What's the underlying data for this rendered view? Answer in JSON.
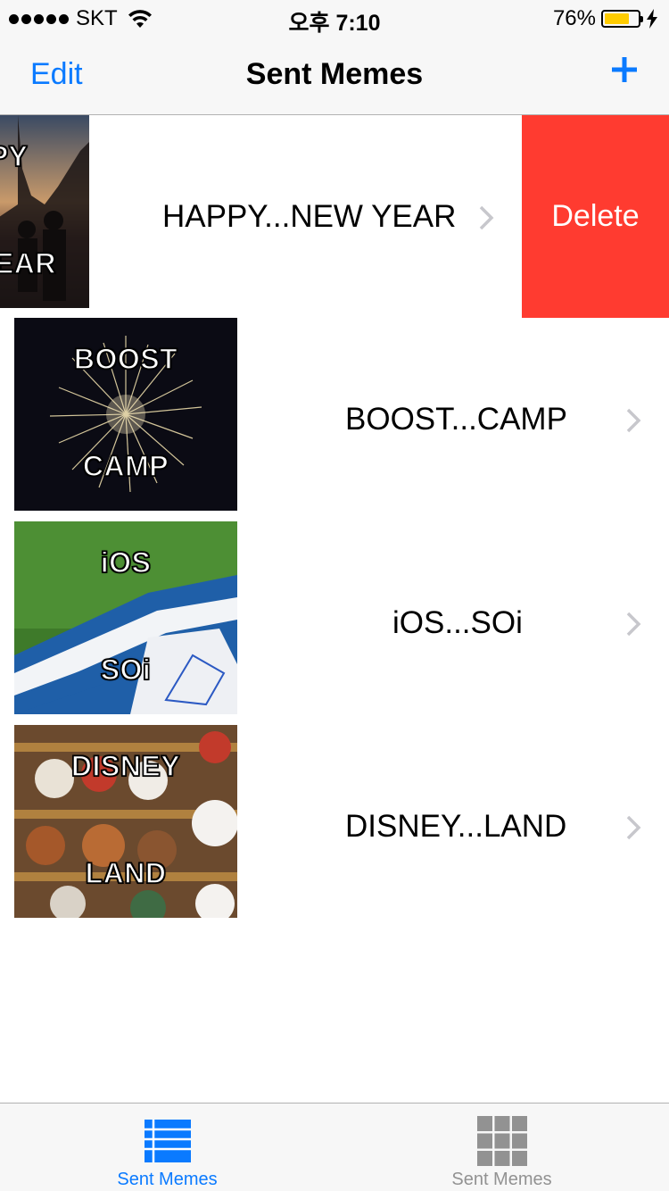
{
  "status_bar": {
    "carrier": "SKT",
    "time": "오후 7:10",
    "battery_percent": "76%",
    "battery_level": 0.76,
    "signal_icon": "signal-dots-icon",
    "wifi_icon": "wifi-icon",
    "charging_icon": "bolt-icon"
  },
  "nav": {
    "edit_label": "Edit",
    "title": "Sent Memes",
    "add_icon": "plus-icon"
  },
  "colors": {
    "accent": "#0a7aff",
    "delete": "#ff3b30",
    "bar_bg": "#f7f7f7",
    "battery": "#ffcc00"
  },
  "memes": [
    {
      "top_text": "HAPPY",
      "bottom_text": "NEW YEAR",
      "label": "HAPPY...NEW YEAR",
      "swiped": true
    },
    {
      "top_text": "BOOST",
      "bottom_text": "CAMP",
      "label": "BOOST...CAMP",
      "swiped": false
    },
    {
      "top_text": "iOS",
      "bottom_text": "SOi",
      "label": "iOS...SOi",
      "swiped": false
    },
    {
      "top_text": "DISNEY",
      "bottom_text": "LAND",
      "label": "DISNEY...LAND",
      "swiped": false
    }
  ],
  "row_action": {
    "delete_label": "Delete"
  },
  "tabs": [
    {
      "label": "Sent Memes",
      "icon": "list-icon",
      "active": true
    },
    {
      "label": "Sent Memes",
      "icon": "grid-icon",
      "active": false
    }
  ]
}
